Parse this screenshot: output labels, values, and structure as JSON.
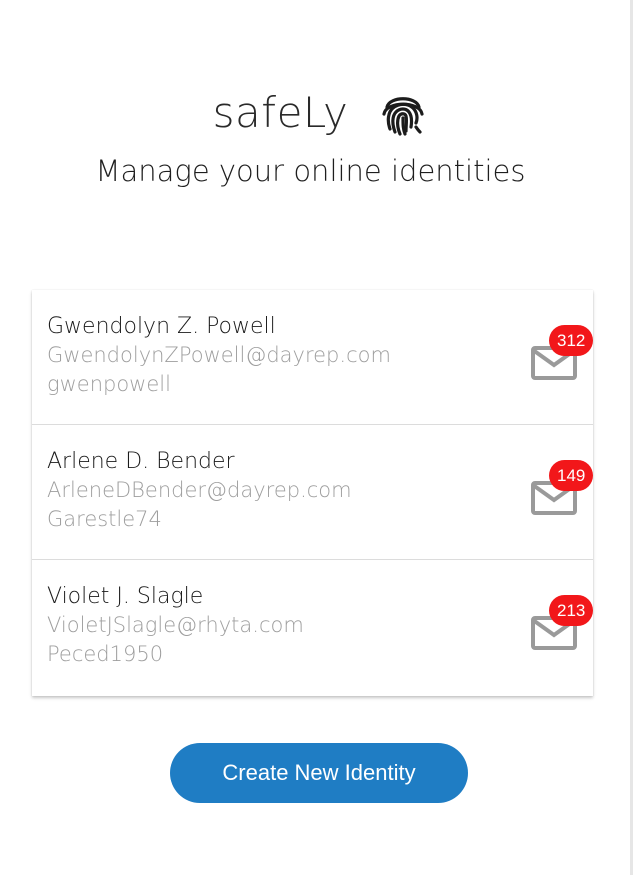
{
  "app": {
    "name": "safeLy",
    "logo_icon": "fingerprint-icon",
    "tagline": "Manage your online identities"
  },
  "identities": [
    {
      "name": "Gwendolyn Z. Powell",
      "email": "GwendolynZPowell@dayrep.com",
      "username": "gwenpowell",
      "unread": "312",
      "icon": "mail-icon"
    },
    {
      "name": "Arlene D. Bender",
      "email": "ArleneDBender@dayrep.com",
      "username": "Garestle74",
      "unread": "149",
      "icon": "mail-icon"
    },
    {
      "name": "Violet J. Slagle",
      "email": "VioletJSlagle@rhyta.com",
      "username": "Peced1950",
      "unread": "213",
      "icon": "mail-icon"
    }
  ],
  "actions": {
    "create_label": "Create New Identity"
  },
  "colors": {
    "accent": "#1f7dc4",
    "badge": "#f2171a",
    "secondary_text": "#9e9e9e",
    "icon_gray": "#9a9a9a"
  }
}
